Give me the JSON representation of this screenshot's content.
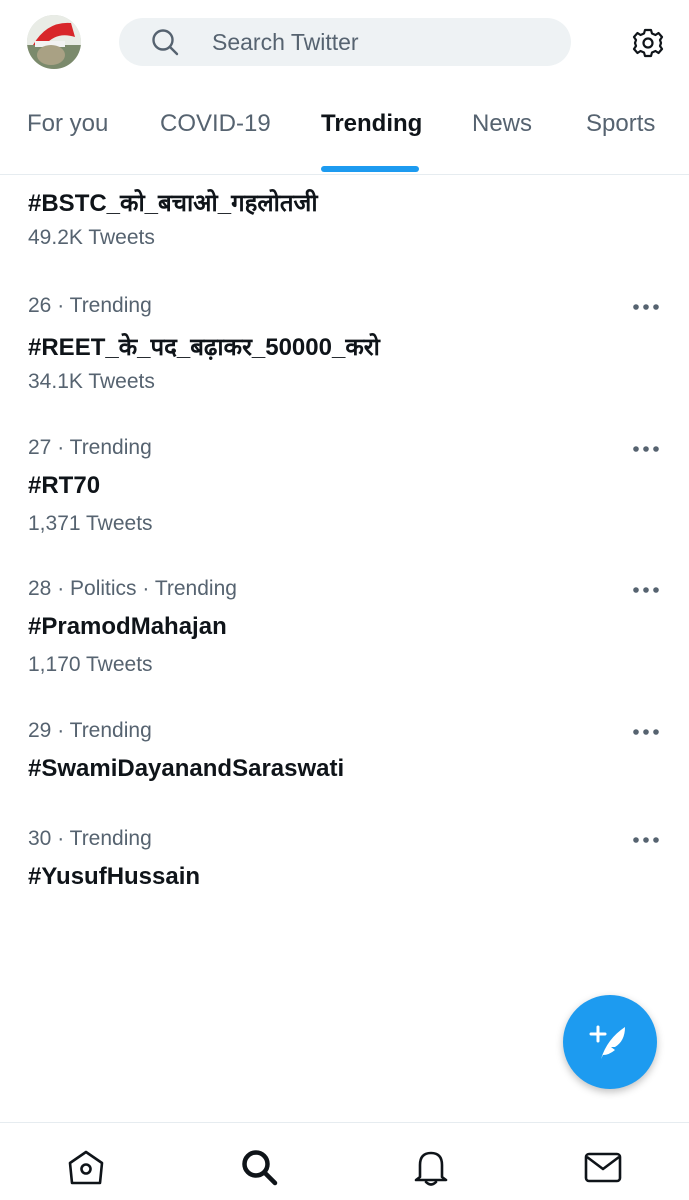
{
  "header": {
    "search_placeholder": "Search Twitter"
  },
  "tabs": [
    {
      "label": "For you"
    },
    {
      "label": "COVID-19"
    },
    {
      "label": "Trending"
    },
    {
      "label": "News"
    },
    {
      "label": "Sports"
    }
  ],
  "active_tab": "Trending",
  "trends": [
    {
      "meta": "",
      "name": "#BSTC_को_बचाओ_गहलोतजी",
      "count": "49.2K Tweets"
    },
    {
      "meta": "26 · Trending",
      "name": "#REET_के_पद_बढ़ाकर_50000_करो",
      "count": "34.1K Tweets"
    },
    {
      "meta": "27 · Trending",
      "name": "#RT70",
      "count": "1,371 Tweets"
    },
    {
      "meta": "28 · Politics · Trending",
      "name": "#PramodMahajan",
      "count": "1,170 Tweets"
    },
    {
      "meta": "29 · Trending",
      "name": "#SwamiDayanandSaraswati",
      "count": ""
    },
    {
      "meta": "30 · Trending",
      "name": "#YusufHussain",
      "count": ""
    }
  ],
  "icons": {
    "settings": "gear-icon",
    "compose": "compose-tweet-icon",
    "home": "home-icon",
    "search": "search-icon",
    "notifications": "bell-icon",
    "messages": "mail-icon",
    "more": "more-dots-icon"
  },
  "colors": {
    "accent": "#1d9bf0",
    "secondary_text": "#566370",
    "primary_text": "#0f1419"
  }
}
